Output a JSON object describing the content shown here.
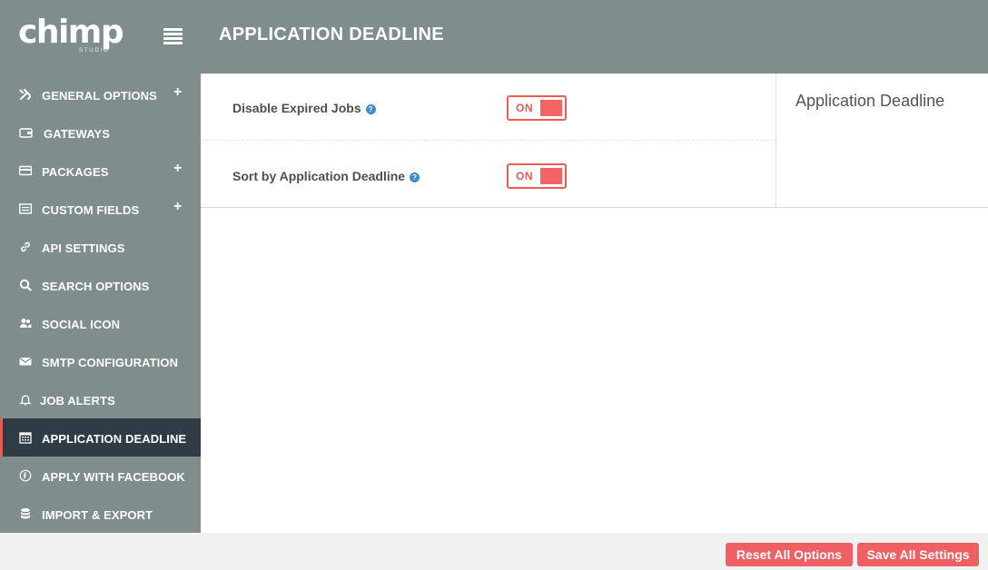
{
  "header": {
    "logo_text": "chimp",
    "logo_sub": "STUDIO",
    "title": "APPLICATION DEADLINE"
  },
  "sidebar": {
    "items": [
      {
        "label": "GENERAL OPTIONS",
        "icon": "wrench-screwdriver-icon",
        "expandable": true
      },
      {
        "label": "GATEWAYS",
        "icon": "wallet-icon",
        "expandable": false
      },
      {
        "label": "PACKAGES",
        "icon": "credit-card-icon",
        "expandable": true
      },
      {
        "label": "CUSTOM FIELDS",
        "icon": "list-box-icon",
        "expandable": true
      },
      {
        "label": "API SETTINGS",
        "icon": "link-icon",
        "expandable": false
      },
      {
        "label": "SEARCH OPTIONS",
        "icon": "search-icon",
        "expandable": false
      },
      {
        "label": "SOCIAL ICON",
        "icon": "users-icon",
        "expandable": false
      },
      {
        "label": "SMTP CONFIGURATION",
        "icon": "envelope-icon",
        "expandable": false
      },
      {
        "label": "JOB ALERTS",
        "icon": "bell-icon",
        "expandable": false
      },
      {
        "label": "APPLICATION DEADLINE",
        "icon": "calendar-icon",
        "expandable": false,
        "active": true
      },
      {
        "label": "APPLY WITH FACEBOOK",
        "icon": "facebook-icon",
        "expandable": false
      },
      {
        "label": "IMPORT & EXPORT",
        "icon": "database-icon",
        "expandable": false
      }
    ]
  },
  "settings": [
    {
      "label": "Disable Expired Jobs",
      "value": "ON"
    },
    {
      "label": "Sort by Application Deadline",
      "value": "ON"
    }
  ],
  "side_panel": {
    "title": "Application Deadline"
  },
  "footer": {
    "reset_label": "Reset All Options",
    "save_label": "Save All Settings"
  },
  "colors": {
    "header_bg": "#7f8e8d",
    "active_nav_bg": "#2f3c45",
    "accent": "#ef5f63"
  }
}
